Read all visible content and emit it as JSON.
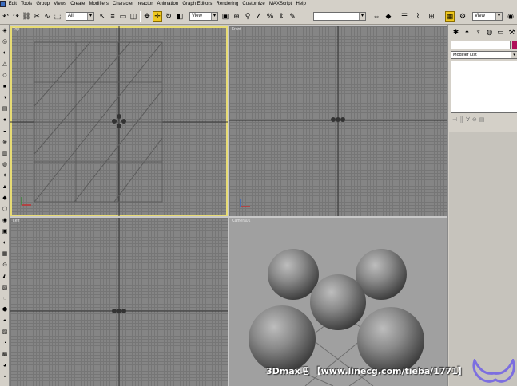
{
  "menubar": {
    "items": [
      "Edit",
      "Tools",
      "Group",
      "Views",
      "Create",
      "Modifiers",
      "Character",
      "reactor",
      "Animation",
      "Graph Editors",
      "Rendering",
      "Customize",
      "MAXScript",
      "Help"
    ]
  },
  "toolbar": {
    "selection_filter": "All",
    "reference_coord": "View",
    "named_selection": "",
    "render_view": "View",
    "icons": [
      "undo-icon",
      "redo-icon",
      "link-icon",
      "unlink-icon",
      "bind-space-warp-icon",
      "select-icon",
      "select-by-name-icon",
      "region-select-icon",
      "window-crossing-icon",
      "select-move-icon",
      "select-rotate-icon",
      "select-scale-icon",
      "pivot-icon",
      "mirror-icon",
      "align-icon",
      "curve-editor-icon",
      "material-editor-icon",
      "render-icon"
    ]
  },
  "viewports": {
    "top": "Top",
    "front": "Front",
    "left": "Left",
    "camera": "Camera01"
  },
  "command_panel": {
    "object_name": "",
    "modifier_list": "Modifier List",
    "swatch_color": "#b0105a"
  },
  "watermark": {
    "text": "3Dmax吧 【www.linecg.com/tieba/1771】"
  },
  "colors": {
    "active_viewport_border": "#e8dc74",
    "selected_tool": "#f0c81e"
  }
}
